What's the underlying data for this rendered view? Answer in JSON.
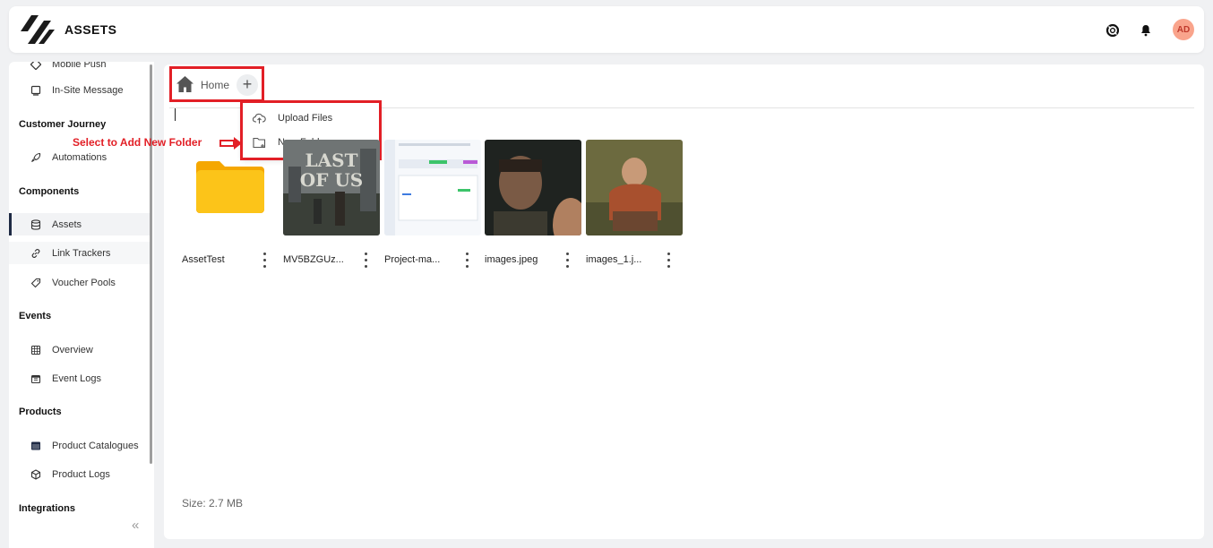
{
  "header": {
    "title": "ASSETS",
    "avatar_initials": "AD",
    "icons": [
      "logo-icon",
      "help-icon",
      "bell-icon"
    ]
  },
  "sidebar": {
    "items_top": [
      {
        "label": "Mobile Push",
        "icon": "mobile-push-icon"
      },
      {
        "label": "In-Site Message",
        "icon": "message-icon"
      }
    ],
    "sections": {
      "customer_journey": "Customer Journey",
      "components": "Components",
      "events": "Events",
      "products": "Products",
      "integrations": "Integrations"
    },
    "customer_journey_items": [
      {
        "label": "Automations",
        "icon": "rocket-icon"
      }
    ],
    "components_items": [
      {
        "label": "Assets",
        "icon": "database-icon",
        "active": true
      },
      {
        "label": "Link Trackers",
        "icon": "link-icon"
      },
      {
        "label": "Voucher Pools",
        "icon": "tag-icon"
      }
    ],
    "events_items": [
      {
        "label": "Overview",
        "icon": "grid-icon"
      },
      {
        "label": "Event Logs",
        "icon": "calendar-icon"
      }
    ],
    "products_items": [
      {
        "label": "Product Catalogues",
        "icon": "catalogue-icon"
      },
      {
        "label": "Product Logs",
        "icon": "box-icon"
      }
    ],
    "collapse_glyph": "«"
  },
  "breadcrumb": {
    "home_label": "Home",
    "plus": "+"
  },
  "menu": {
    "upload_files": "Upload Files",
    "new_folder": "New Folder"
  },
  "annotation": {
    "text": "Select to Add New Folder",
    "color": "#e21f26"
  },
  "files": [
    {
      "name": "AssetTest",
      "type": "folder"
    },
    {
      "name": "MV5BZGUz...",
      "type": "image"
    },
    {
      "name": "Project-ma...",
      "type": "image"
    },
    {
      "name": "images.jpeg",
      "type": "image"
    },
    {
      "name": "images_1.j...",
      "type": "image"
    }
  ],
  "footer": {
    "size": "Size: 2.7 MB"
  },
  "colors": {
    "accent": "#1e2a44",
    "highlight": "#e21f26",
    "folder": "#fcc419"
  }
}
